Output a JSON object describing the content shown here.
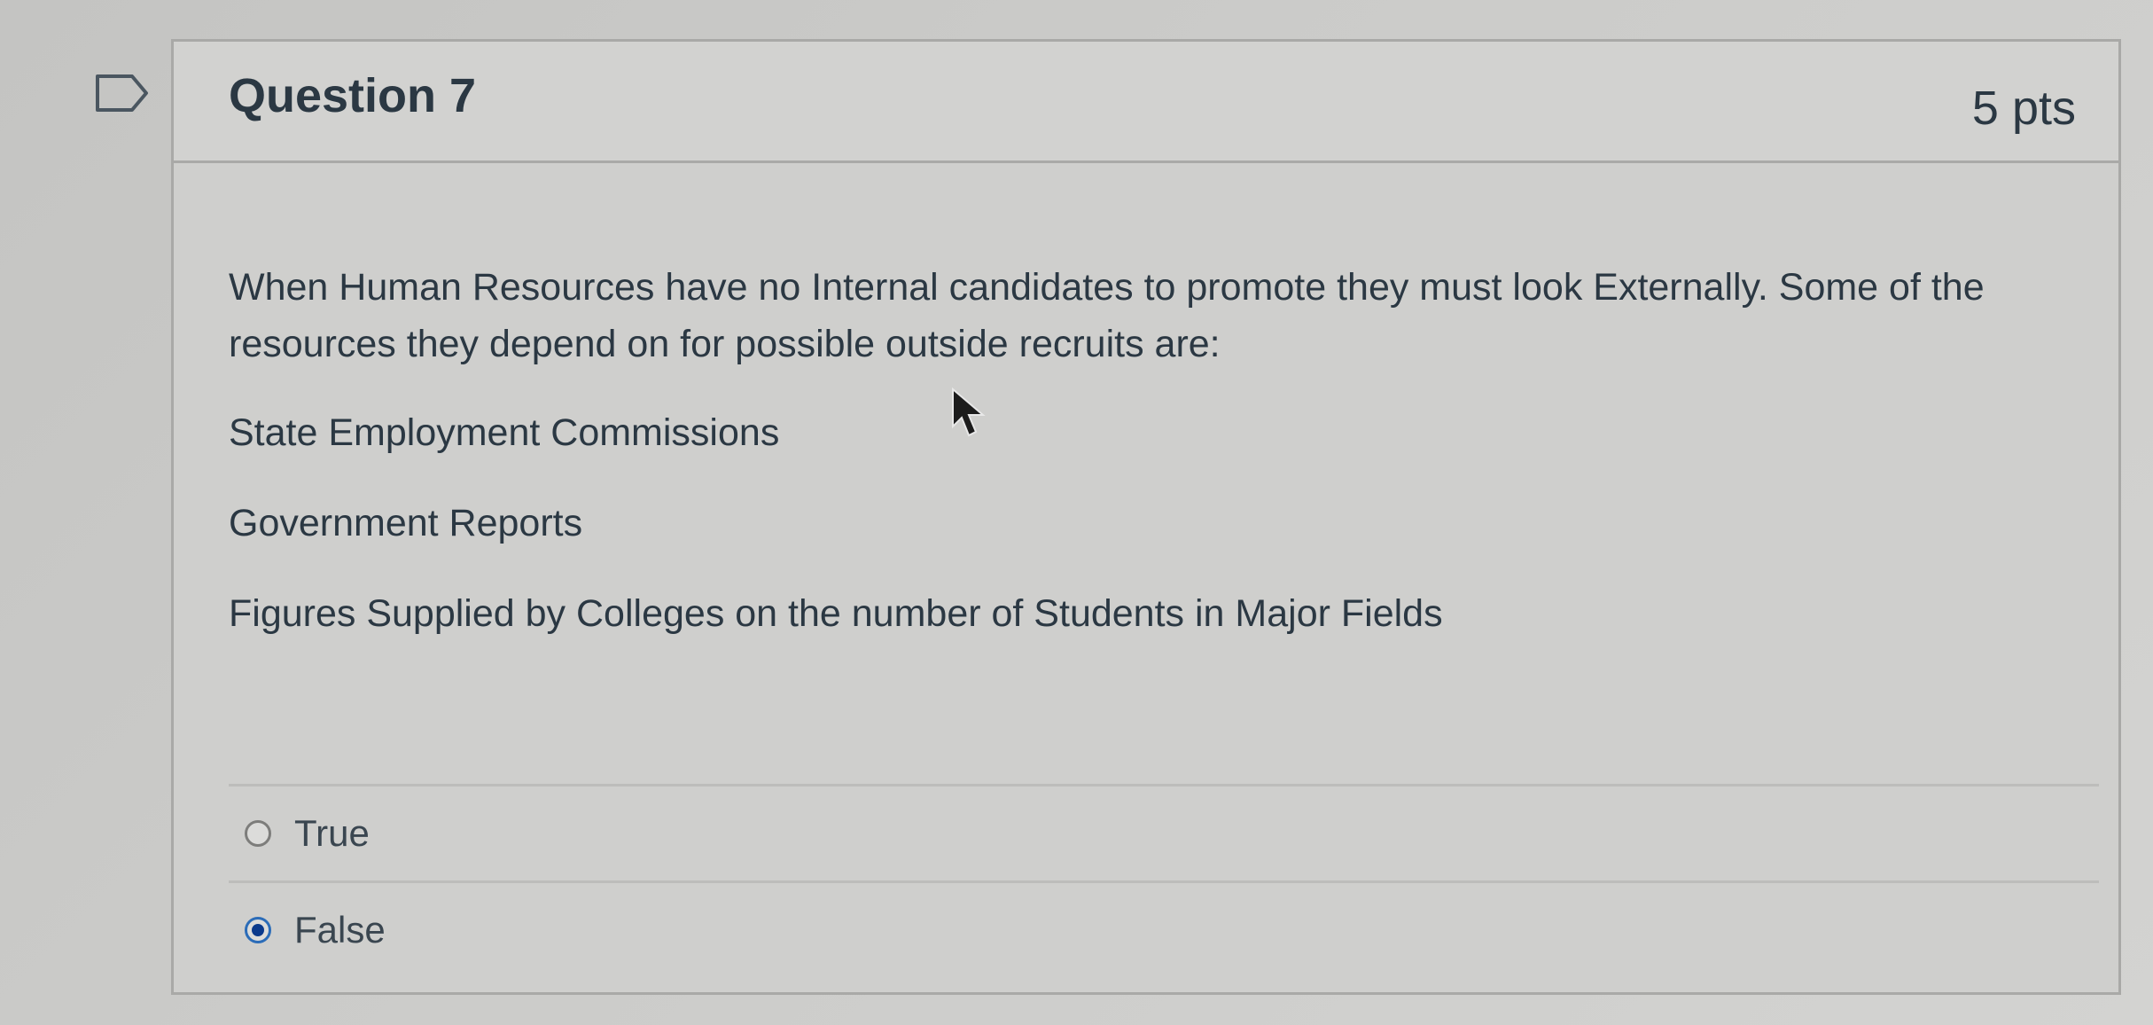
{
  "question": {
    "title": "Question 7",
    "points": "5 pts",
    "prompt": "When Human Resources have no Internal candidates to promote they must look Externally. Some of the resources they depend on for possible outside recruits are:",
    "items": [
      "State Employment Commissions",
      "Government Reports",
      "Figures Supplied by Colleges on the number of Students in Major Fields"
    ],
    "answers": [
      {
        "label": "True",
        "selected": false
      },
      {
        "label": "False",
        "selected": true
      }
    ]
  },
  "colors": {
    "selected_radio": "#0b3a8c",
    "text": "#2b3843"
  },
  "icons": {
    "flag": "flag-question-icon",
    "cursor": "mouse-pointer-icon"
  }
}
